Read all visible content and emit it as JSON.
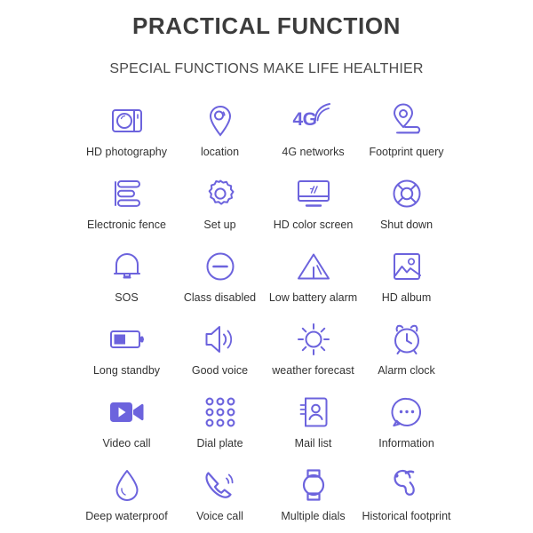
{
  "header": {
    "title": "PRACTICAL FUNCTION",
    "subtitle": "SPECIAL FUNCTIONS MAKE LIFE HEALTHIER"
  },
  "theme": {
    "accent": "#6c63dd",
    "text": "#333333",
    "title_color": "#3c3c3c",
    "background": "#ffffff"
  },
  "features": [
    {
      "label": "HD photography",
      "icon": "camera-icon"
    },
    {
      "label": "location",
      "icon": "location-pin-icon"
    },
    {
      "label": "4G networks",
      "icon": "4g-signal-icon",
      "badge": "4G"
    },
    {
      "label": "Footprint query",
      "icon": "footprint-query-icon"
    },
    {
      "label": "Electronic fence",
      "icon": "stacked-bars-icon"
    },
    {
      "label": "Set up",
      "icon": "gear-icon"
    },
    {
      "label": "HD color screen",
      "icon": "monitor-icon"
    },
    {
      "label": "Shut down",
      "icon": "lifebuoy-power-icon"
    },
    {
      "label": "SOS",
      "icon": "bell-icon"
    },
    {
      "label": "Class disabled",
      "icon": "minus-circle-icon"
    },
    {
      "label": "Low battery alarm",
      "icon": "warning-triangle-icon"
    },
    {
      "label": "HD album",
      "icon": "image-icon"
    },
    {
      "label": "Long standby",
      "icon": "battery-icon"
    },
    {
      "label": "Good voice",
      "icon": "speaker-icon"
    },
    {
      "label": "weather forecast",
      "icon": "sun-icon"
    },
    {
      "label": "Alarm clock",
      "icon": "alarm-clock-icon"
    },
    {
      "label": "Video call",
      "icon": "video-camera-icon"
    },
    {
      "label": "Dial plate",
      "icon": "dial-pad-icon"
    },
    {
      "label": "Mail list",
      "icon": "contact-book-icon"
    },
    {
      "label": "Information",
      "icon": "chat-bubble-icon"
    },
    {
      "label": "Deep waterproof",
      "icon": "water-drop-icon"
    },
    {
      "label": "Voice call",
      "icon": "phone-call-icon"
    },
    {
      "label": "Multiple dials",
      "icon": "watch-icon"
    },
    {
      "label": "Historical footprint",
      "icon": "footprint-icon"
    }
  ]
}
